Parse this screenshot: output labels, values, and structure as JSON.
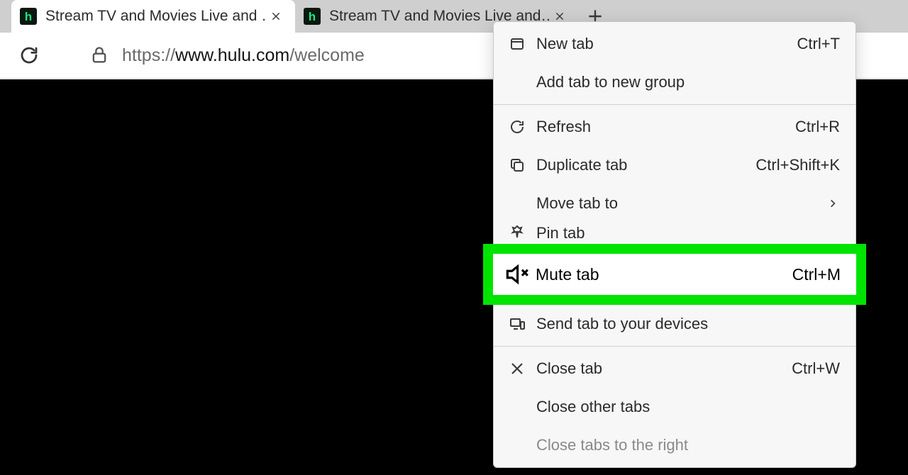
{
  "tabs": {
    "tab1_title": "Stream TV and Movies Live and …",
    "tab2_title": "Stream TV and Movies Live and…"
  },
  "address": {
    "url_scheme": "https://",
    "url_host": "www.hulu.com",
    "url_path": "/welcome"
  },
  "menu": {
    "new_tab": "New tab",
    "new_tab_short": "Ctrl+T",
    "add_to_group": "Add tab to new group",
    "refresh": "Refresh",
    "refresh_short": "Ctrl+R",
    "duplicate": "Duplicate tab",
    "duplicate_short": "Ctrl+Shift+K",
    "move_to": "Move tab to",
    "pin": "Pin tab",
    "mute": "Mute tab",
    "mute_short": "Ctrl+M",
    "send": "Send tab to your devices",
    "close": "Close tab",
    "close_short": "Ctrl+W",
    "close_other": "Close other tabs",
    "close_right": "Close tabs to the right"
  }
}
